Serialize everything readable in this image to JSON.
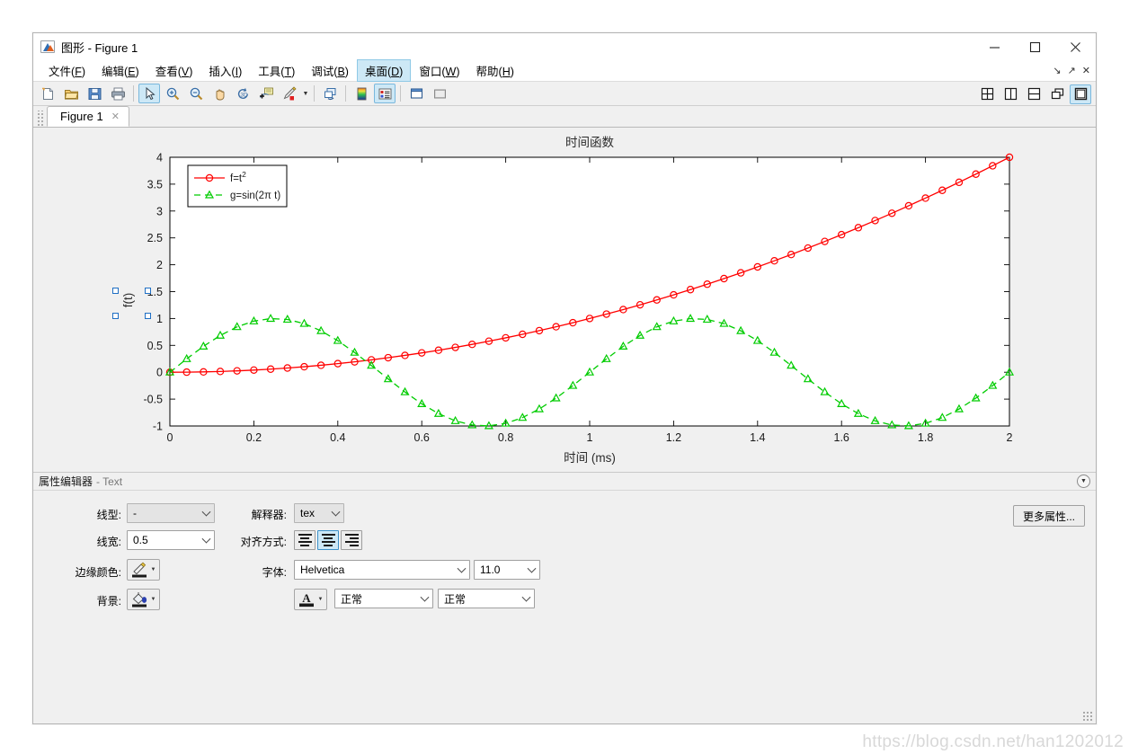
{
  "window": {
    "title": "图形 - Figure 1",
    "app_icon": "matlab-figure-icon",
    "minimize": "—",
    "maximize": "☐",
    "close": "✕"
  },
  "menubar": {
    "items": [
      {
        "label": "文件",
        "accel": "F"
      },
      {
        "label": "编辑",
        "accel": "E"
      },
      {
        "label": "查看",
        "accel": "V"
      },
      {
        "label": "插入",
        "accel": "I"
      },
      {
        "label": "工具",
        "accel": "T"
      },
      {
        "label": "调试",
        "accel": "B"
      },
      {
        "label": "桌面",
        "accel": "D",
        "active": true
      },
      {
        "label": "窗口",
        "accel": "W"
      },
      {
        "label": "帮助",
        "accel": "H"
      }
    ],
    "right_icons": [
      "minimize-panel-icon",
      "undock-icon",
      "close-panel-icon"
    ]
  },
  "toolbar": {
    "buttons": [
      "new-figure-icon",
      "open-file-icon",
      "save-icon",
      "print-icon",
      "pointer-icon",
      "zoom-in-icon",
      "zoom-out-icon",
      "pan-icon",
      "rotate-3d-icon",
      "data-cursor-icon",
      "brush-icon",
      "link-data-icon",
      "colorbar-icon",
      "legend-icon",
      "new-axes-icon",
      "plot-browser-icon"
    ],
    "right_buttons": [
      "tile-4-icon",
      "tile-vertical-icon",
      "tile-horizontal-icon",
      "cascade-icon",
      "single-pane-icon"
    ],
    "selected": [
      "pointer-icon",
      "legend-icon"
    ],
    "right_selected": "single-pane-icon"
  },
  "tabs": {
    "items": [
      {
        "label": "Figure 1",
        "close": "✕",
        "active": true
      }
    ]
  },
  "chart_data": {
    "type": "line",
    "title": "时间函数",
    "xlabel": "时间 (ms)",
    "ylabel": "f(t)",
    "ylabel_selected": true,
    "xlim": [
      0,
      2
    ],
    "ylim": [
      -1,
      4
    ],
    "xticks": [
      0,
      0.2,
      0.4,
      0.6,
      0.8,
      1,
      1.2,
      1.4,
      1.6,
      1.8,
      2
    ],
    "xticklabels": [
      "0",
      "0.2",
      "0.4",
      "0.6",
      "0.8",
      "1",
      "1.2",
      "1.4",
      "1.6",
      "1.8",
      "2"
    ],
    "yticks": [
      -1,
      -0.5,
      0,
      0.5,
      1,
      1.5,
      2,
      2.5,
      3,
      3.5,
      4
    ],
    "yticklabels": [
      "-1",
      "-0.5",
      "0",
      "0.5",
      "1",
      "1.5",
      "2",
      "2.5",
      "3",
      "3.5",
      "4"
    ],
    "grid": false,
    "legend_position": "top-left",
    "series": [
      {
        "name": "f=t^2",
        "legend_label": "f=t",
        "legend_sup": "2",
        "color": "#ff0000",
        "linestyle": "solid",
        "marker": "circle",
        "x": [
          0,
          0.04,
          0.08,
          0.12,
          0.16,
          0.2,
          0.24,
          0.28,
          0.32,
          0.36,
          0.4,
          0.44,
          0.48,
          0.52,
          0.56,
          0.6,
          0.64,
          0.68,
          0.72,
          0.76,
          0.8,
          0.84,
          0.88,
          0.92,
          0.96,
          1,
          1.04,
          1.08,
          1.12,
          1.16,
          1.2,
          1.24,
          1.28,
          1.32,
          1.36,
          1.4,
          1.44,
          1.48,
          1.52,
          1.56,
          1.6,
          1.64,
          1.68,
          1.72,
          1.76,
          1.8,
          1.84,
          1.88,
          1.92,
          1.96,
          2
        ],
        "y": [
          0,
          0.0016,
          0.0064,
          0.0144,
          0.0256,
          0.04,
          0.0576,
          0.0784,
          0.1024,
          0.1296,
          0.16,
          0.1936,
          0.2304,
          0.2704,
          0.3136,
          0.36,
          0.4096,
          0.4624,
          0.5184,
          0.5776,
          0.64,
          0.7056,
          0.7744,
          0.8464,
          0.9216,
          1,
          1.0816,
          1.1664,
          1.2544,
          1.3456,
          1.44,
          1.5376,
          1.6384,
          1.7424,
          1.8496,
          1.96,
          2.0736,
          2.1904,
          2.3104,
          2.4336,
          2.56,
          2.6896,
          2.8224,
          2.9584,
          3.0976,
          3.24,
          3.3856,
          3.5344,
          3.6864,
          3.8416,
          4
        ]
      },
      {
        "name": "g=sin(2*pi*t)",
        "legend_label": "g=sin(2π t)",
        "color": "#00cc00",
        "linestyle": "dashed",
        "marker": "triangle",
        "x": [
          0,
          0.04,
          0.08,
          0.12,
          0.16,
          0.2,
          0.24,
          0.28,
          0.32,
          0.36,
          0.4,
          0.44,
          0.48,
          0.52,
          0.56,
          0.6,
          0.64,
          0.68,
          0.72,
          0.76,
          0.8,
          0.84,
          0.88,
          0.92,
          0.96,
          1,
          1.04,
          1.08,
          1.12,
          1.16,
          1.2,
          1.24,
          1.28,
          1.32,
          1.36,
          1.4,
          1.44,
          1.48,
          1.52,
          1.56,
          1.6,
          1.64,
          1.68,
          1.72,
          1.76,
          1.8,
          1.84,
          1.88,
          1.92,
          1.96,
          2
        ],
        "y": [
          0,
          0.2487,
          0.4818,
          0.6845,
          0.8443,
          0.9511,
          0.998,
          0.9823,
          0.905,
          0.7705,
          0.5878,
          0.3681,
          0.1253,
          -0.1253,
          -0.3681,
          -0.5878,
          -0.7705,
          -0.905,
          -0.9823,
          -0.998,
          -0.9511,
          -0.8443,
          -0.6845,
          -0.4818,
          -0.2487,
          0,
          0.2487,
          0.4818,
          0.6845,
          0.8443,
          0.9511,
          0.998,
          0.9823,
          0.905,
          0.7705,
          0.5878,
          0.3681,
          0.1253,
          -0.1253,
          -0.3681,
          -0.5878,
          -0.7705,
          -0.905,
          -0.9823,
          -0.998,
          -0.9511,
          -0.8443,
          -0.6845,
          -0.4818,
          -0.2487,
          0
        ]
      }
    ]
  },
  "property_editor": {
    "header_main": "属性编辑器",
    "header_sub": "- Text",
    "collapse_icon": "chevron-down-circle-icon",
    "fields": {
      "linestyle_label": "线型:",
      "linestyle_value": "-",
      "linewidth_label": "线宽:",
      "linewidth_value": "0.5",
      "edgecolor_label": "边缘颜色:",
      "edgecolor_icon": "pencil-color-icon",
      "background_label": "背景:",
      "background_icon": "fill-bucket-icon",
      "interpreter_label": "解释器:",
      "interpreter_value": "tex",
      "alignment_label": "对齐方式:",
      "alignment_options": [
        "left-align-icon",
        "center-align-icon",
        "right-align-icon"
      ],
      "alignment_selected": 1,
      "font_label": "字体:",
      "font_family_value": "Helvetica",
      "font_size_value": "11.0",
      "fontcolor_icon": "font-color-icon",
      "font_weight_value": "正常",
      "font_angle_value": "正常"
    },
    "more_button": "更多属性..."
  },
  "watermark": "https://blog.csdn.net/han1202012",
  "colors": {
    "accent": "#cde8f6",
    "series_red": "#ff0000",
    "series_green": "#00cc00",
    "selection_blue": "#1f6fc4"
  }
}
